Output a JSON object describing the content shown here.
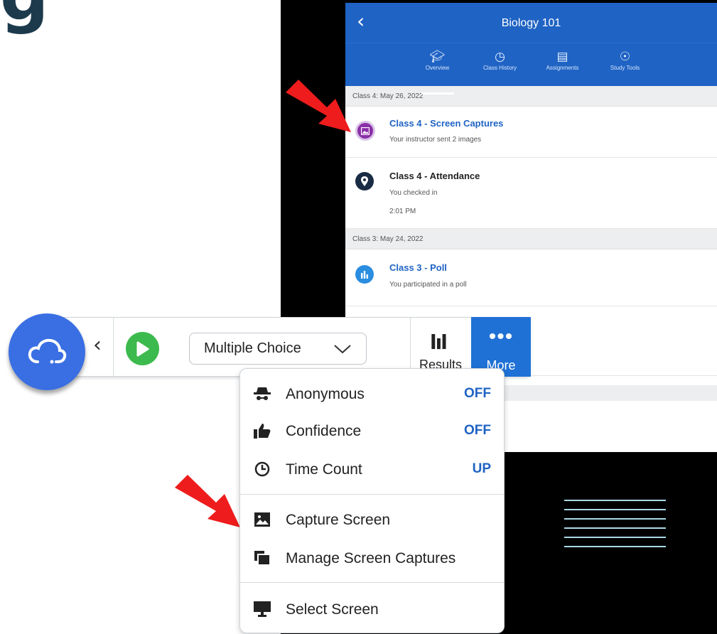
{
  "heading_fragment": "g",
  "phone": {
    "title": "Biology 101",
    "tabs": [
      {
        "label": "Overview",
        "active": true,
        "icon": "graduation-cap-icon"
      },
      {
        "label": "Class History",
        "active": false,
        "icon": "history-icon"
      },
      {
        "label": "Assignments",
        "active": false,
        "icon": "book-icon"
      },
      {
        "label": "Study Tools",
        "active": false,
        "icon": "lightbulb-icon"
      }
    ],
    "sections": [
      {
        "date": "Class 4: May 26, 2022"
      },
      {
        "date": "Class 3: May 24, 2022"
      }
    ],
    "items": [
      {
        "title": "Class 4 - Screen Captures",
        "sub": "Your instructor sent 2 images",
        "color": "#8b2fa8",
        "title_color": "#1f63c4",
        "icon": "image-icon"
      },
      {
        "title": "Class 4 - Attendance",
        "sub": "You checked in",
        "time": "2:01 PM",
        "color": "#1a2b44",
        "title_color": "#222222",
        "icon": "location-pin-icon"
      },
      {
        "title": "Class 3 - Poll",
        "sub": "You participated in a poll",
        "color": "#2a8de0",
        "title_color": "#1f63c4",
        "icon": "poll-icon"
      }
    ]
  },
  "toolbar": {
    "question_type": "Multiple Choice",
    "results_label": "Results",
    "more_label": "More",
    "accent_color": "#1f71d6",
    "play_color": "#3dba4e"
  },
  "menu": {
    "items": [
      {
        "label": "Anonymous",
        "value": "OFF",
        "icon": "spy-icon"
      },
      {
        "label": "Confidence",
        "value": "OFF",
        "icon": "thumbs-up-icon"
      },
      {
        "label": "Time Count",
        "value": "UP",
        "icon": "clock-icon"
      },
      {
        "label": "Capture Screen",
        "value": "",
        "icon": "image-icon"
      },
      {
        "label": "Manage Screen Captures",
        "value": "",
        "icon": "copy-icon"
      },
      {
        "label": "Select Screen",
        "value": "",
        "icon": "monitor-icon"
      }
    ]
  }
}
